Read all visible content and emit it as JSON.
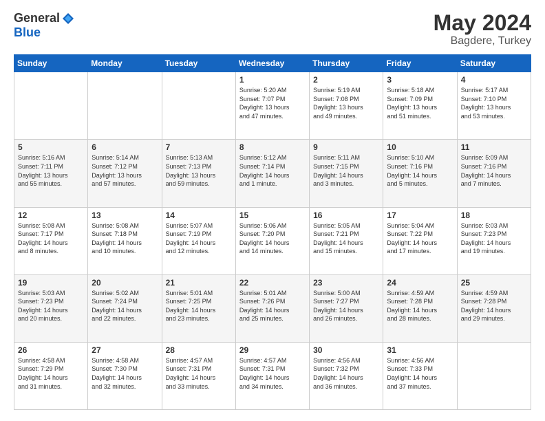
{
  "header": {
    "logo_general": "General",
    "logo_blue": "Blue",
    "month_year": "May 2024",
    "location": "Bagdere, Turkey"
  },
  "weekdays": [
    "Sunday",
    "Monday",
    "Tuesday",
    "Wednesday",
    "Thursday",
    "Friday",
    "Saturday"
  ],
  "weeks": [
    [
      {
        "day": "",
        "info": ""
      },
      {
        "day": "",
        "info": ""
      },
      {
        "day": "",
        "info": ""
      },
      {
        "day": "1",
        "info": "Sunrise: 5:20 AM\nSunset: 7:07 PM\nDaylight: 13 hours\nand 47 minutes."
      },
      {
        "day": "2",
        "info": "Sunrise: 5:19 AM\nSunset: 7:08 PM\nDaylight: 13 hours\nand 49 minutes."
      },
      {
        "day": "3",
        "info": "Sunrise: 5:18 AM\nSunset: 7:09 PM\nDaylight: 13 hours\nand 51 minutes."
      },
      {
        "day": "4",
        "info": "Sunrise: 5:17 AM\nSunset: 7:10 PM\nDaylight: 13 hours\nand 53 minutes."
      }
    ],
    [
      {
        "day": "5",
        "info": "Sunrise: 5:16 AM\nSunset: 7:11 PM\nDaylight: 13 hours\nand 55 minutes."
      },
      {
        "day": "6",
        "info": "Sunrise: 5:14 AM\nSunset: 7:12 PM\nDaylight: 13 hours\nand 57 minutes."
      },
      {
        "day": "7",
        "info": "Sunrise: 5:13 AM\nSunset: 7:13 PM\nDaylight: 13 hours\nand 59 minutes."
      },
      {
        "day": "8",
        "info": "Sunrise: 5:12 AM\nSunset: 7:14 PM\nDaylight: 14 hours\nand 1 minute."
      },
      {
        "day": "9",
        "info": "Sunrise: 5:11 AM\nSunset: 7:15 PM\nDaylight: 14 hours\nand 3 minutes."
      },
      {
        "day": "10",
        "info": "Sunrise: 5:10 AM\nSunset: 7:16 PM\nDaylight: 14 hours\nand 5 minutes."
      },
      {
        "day": "11",
        "info": "Sunrise: 5:09 AM\nSunset: 7:16 PM\nDaylight: 14 hours\nand 7 minutes."
      }
    ],
    [
      {
        "day": "12",
        "info": "Sunrise: 5:08 AM\nSunset: 7:17 PM\nDaylight: 14 hours\nand 8 minutes."
      },
      {
        "day": "13",
        "info": "Sunrise: 5:08 AM\nSunset: 7:18 PM\nDaylight: 14 hours\nand 10 minutes."
      },
      {
        "day": "14",
        "info": "Sunrise: 5:07 AM\nSunset: 7:19 PM\nDaylight: 14 hours\nand 12 minutes."
      },
      {
        "day": "15",
        "info": "Sunrise: 5:06 AM\nSunset: 7:20 PM\nDaylight: 14 hours\nand 14 minutes."
      },
      {
        "day": "16",
        "info": "Sunrise: 5:05 AM\nSunset: 7:21 PM\nDaylight: 14 hours\nand 15 minutes."
      },
      {
        "day": "17",
        "info": "Sunrise: 5:04 AM\nSunset: 7:22 PM\nDaylight: 14 hours\nand 17 minutes."
      },
      {
        "day": "18",
        "info": "Sunrise: 5:03 AM\nSunset: 7:23 PM\nDaylight: 14 hours\nand 19 minutes."
      }
    ],
    [
      {
        "day": "19",
        "info": "Sunrise: 5:03 AM\nSunset: 7:23 PM\nDaylight: 14 hours\nand 20 minutes."
      },
      {
        "day": "20",
        "info": "Sunrise: 5:02 AM\nSunset: 7:24 PM\nDaylight: 14 hours\nand 22 minutes."
      },
      {
        "day": "21",
        "info": "Sunrise: 5:01 AM\nSunset: 7:25 PM\nDaylight: 14 hours\nand 23 minutes."
      },
      {
        "day": "22",
        "info": "Sunrise: 5:01 AM\nSunset: 7:26 PM\nDaylight: 14 hours\nand 25 minutes."
      },
      {
        "day": "23",
        "info": "Sunrise: 5:00 AM\nSunset: 7:27 PM\nDaylight: 14 hours\nand 26 minutes."
      },
      {
        "day": "24",
        "info": "Sunrise: 4:59 AM\nSunset: 7:28 PM\nDaylight: 14 hours\nand 28 minutes."
      },
      {
        "day": "25",
        "info": "Sunrise: 4:59 AM\nSunset: 7:28 PM\nDaylight: 14 hours\nand 29 minutes."
      }
    ],
    [
      {
        "day": "26",
        "info": "Sunrise: 4:58 AM\nSunset: 7:29 PM\nDaylight: 14 hours\nand 31 minutes."
      },
      {
        "day": "27",
        "info": "Sunrise: 4:58 AM\nSunset: 7:30 PM\nDaylight: 14 hours\nand 32 minutes."
      },
      {
        "day": "28",
        "info": "Sunrise: 4:57 AM\nSunset: 7:31 PM\nDaylight: 14 hours\nand 33 minutes."
      },
      {
        "day": "29",
        "info": "Sunrise: 4:57 AM\nSunset: 7:31 PM\nDaylight: 14 hours\nand 34 minutes."
      },
      {
        "day": "30",
        "info": "Sunrise: 4:56 AM\nSunset: 7:32 PM\nDaylight: 14 hours\nand 36 minutes."
      },
      {
        "day": "31",
        "info": "Sunrise: 4:56 AM\nSunset: 7:33 PM\nDaylight: 14 hours\nand 37 minutes."
      },
      {
        "day": "",
        "info": ""
      }
    ]
  ]
}
